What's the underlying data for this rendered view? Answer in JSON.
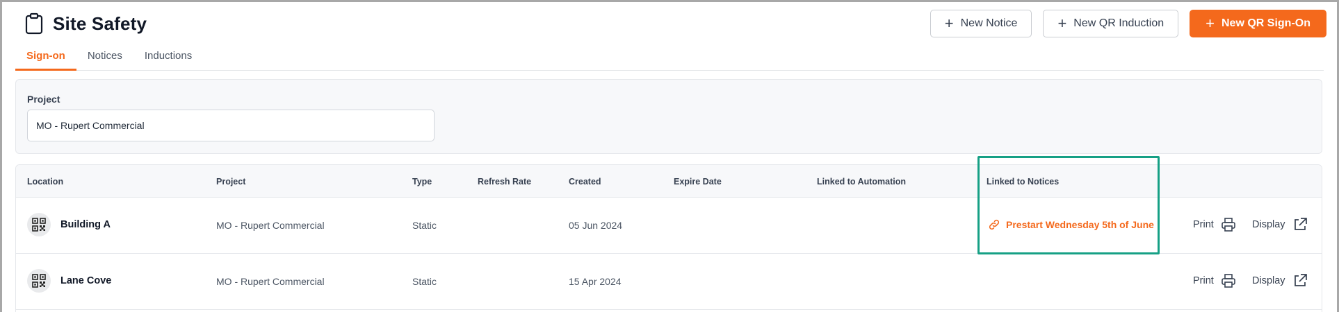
{
  "header": {
    "title": "Site Safety",
    "actions": {
      "new_notice": "New Notice",
      "new_qr_induction": "New QR Induction",
      "new_qr_signon": "New QR Sign-On"
    }
  },
  "tabs": [
    {
      "label": "Sign-on",
      "active": true
    },
    {
      "label": "Notices",
      "active": false
    },
    {
      "label": "Inductions",
      "active": false
    }
  ],
  "filter": {
    "label": "Project",
    "value": "MO - Rupert Commercial"
  },
  "table": {
    "columns": [
      "Location",
      "Project",
      "Type",
      "Refresh Rate",
      "Created",
      "Expire Date",
      "Linked to Automation",
      "Linked to Notices"
    ],
    "rows": [
      {
        "location": "Building A",
        "project": "MO - Rupert Commercial",
        "type": "Static",
        "refresh_rate": "",
        "created": "05 Jun 2024",
        "expire_date": "",
        "linked_automation": "",
        "linked_notice": "Prestart Wednesday 5th of June",
        "print": "Print",
        "display": "Display"
      },
      {
        "location": "Lane Cove",
        "project": "MO - Rupert Commercial",
        "type": "Static",
        "refresh_rate": "",
        "created": "15 Apr 2024",
        "expire_date": "",
        "linked_automation": "",
        "linked_notice": "",
        "print": "Print",
        "display": "Display"
      }
    ]
  },
  "colors": {
    "accent": "#f4691c",
    "highlight": "#16a085"
  }
}
